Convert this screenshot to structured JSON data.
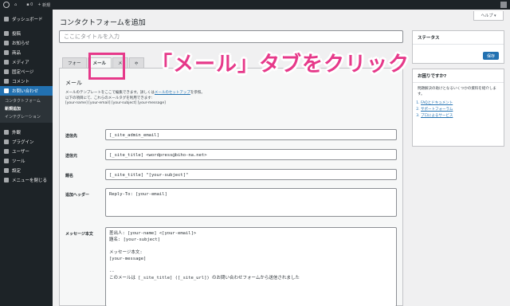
{
  "admin_bar": {
    "site": "",
    "comments": "0",
    "plus": "+",
    "new": "新規"
  },
  "sidebar": {
    "items": [
      {
        "label": "ダッシュボード",
        "icon": "dashboard-icon"
      },
      {
        "label": "投稿",
        "icon": "pin-icon"
      },
      {
        "label": "お知らせ",
        "icon": "pin-icon"
      },
      {
        "label": "商品",
        "icon": "pin-icon"
      },
      {
        "label": "メディア",
        "icon": "media-icon"
      },
      {
        "label": "固定ページ",
        "icon": "page-icon"
      },
      {
        "label": "コメント",
        "icon": "comment-icon"
      },
      {
        "label": "お問い合わせ",
        "icon": "mail-icon"
      }
    ],
    "submenu": [
      "コンタクトフォーム",
      "新規追加",
      "インテグレーション"
    ],
    "lower_items": [
      {
        "label": "外観",
        "icon": "brush-icon"
      },
      {
        "label": "プラグイン",
        "icon": "plugin-icon"
      },
      {
        "label": "ユーザー",
        "icon": "user-icon"
      },
      {
        "label": "ツール",
        "icon": "tool-icon"
      },
      {
        "label": "設定",
        "icon": "settings-icon"
      },
      {
        "label": "メニューを閉じる",
        "icon": "collapse-icon"
      }
    ]
  },
  "header": {
    "title": "コンタクトフォームを追加",
    "help": "ヘルプ ▾",
    "title_placeholder": "ここにタイトルを入力"
  },
  "tabs": [
    "フォー",
    "メール",
    "メ",
    "ゃ"
  ],
  "mail_panel": {
    "heading": "メール",
    "desc_line1_a": "メールのテンプレートをここで編集できます。詳しくは",
    "desc_line1_link": "メールのセットアップ",
    "desc_line1_b": "を参照。",
    "desc_line2": "以下の項目にて、これらのメールタグを利用できます:",
    "desc_line3": "[your-name] [your-email] [your-subject] [your-message]",
    "fields": [
      {
        "label": "送信先",
        "value": "[_site_admin_email]"
      },
      {
        "label": "送信元",
        "value": "[_site_title] <wordpress@biho-na.net>"
      },
      {
        "label": "題名",
        "value": "[_site_title] \"[your-subject]\""
      },
      {
        "label": "追加ヘッダー",
        "value": "Reply-To: [your-email]"
      },
      {
        "label": "メッセージ本文",
        "value": "差出人: [your-name] <[your-email]>\n題名: [your-subject]\n\nメッセージ本文:\n[your-message]\n\n--\nこのメールは [_site_title] ([_site_url]) のお問い合わせフォームから送信されました"
      }
    ]
  },
  "status_box": {
    "title": "ステータス",
    "save": "保存"
  },
  "help_box": {
    "title": "お困りですか?",
    "text": "問題解決の助けとなるいくつかの資料を紹介します。",
    "links": [
      "FAQとドキュメント",
      "サポートフォーラム",
      "プロによるサービス"
    ]
  },
  "annotation": {
    "callout": "「メール」タブをクリック",
    "color": "#e6398a"
  }
}
